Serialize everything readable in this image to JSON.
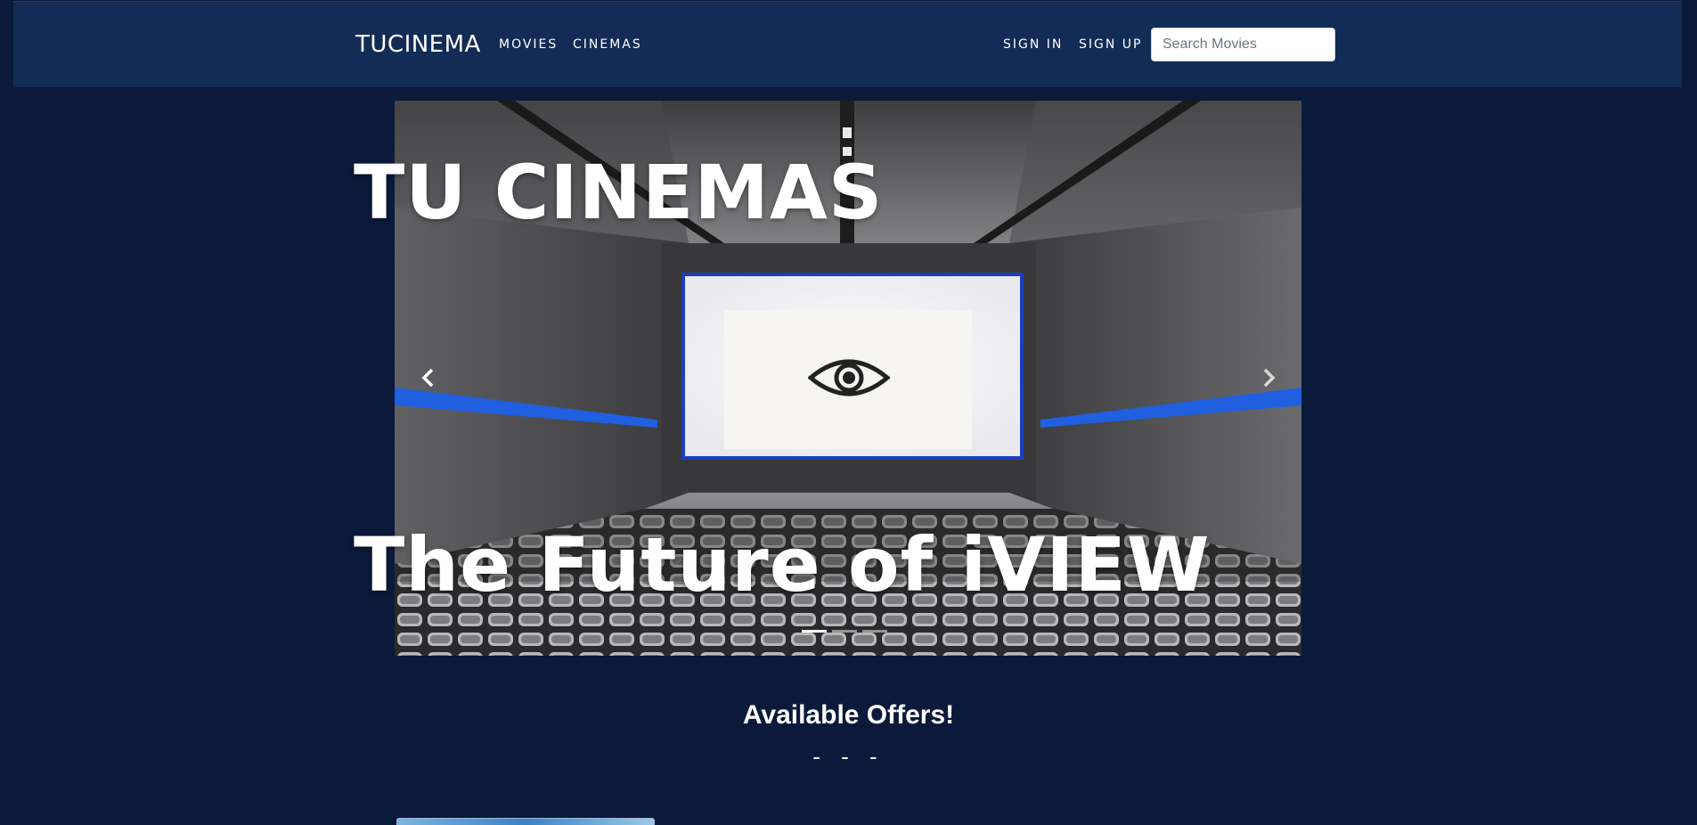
{
  "navbar": {
    "brand": "TUCINEMA",
    "links": [
      "MOVIES",
      "CINEMAS"
    ],
    "auth": [
      "SIGN IN",
      "SIGN UP"
    ],
    "search_placeholder": "Search Movies"
  },
  "carousel": {
    "title": "TU CINEMAS",
    "subtitle": "The Future of iVIEW",
    "prev_icon": "chevron-left-icon",
    "next_icon": "chevron-right-icon",
    "slide_count": 3,
    "active_slide": 1
  },
  "offers": {
    "title": "Available Offers!",
    "divider": "- - -"
  },
  "colors": {
    "page_background": "#0b1a3b",
    "navbar_background": "#122c55",
    "accent_blue": "#1f5fe0"
  }
}
